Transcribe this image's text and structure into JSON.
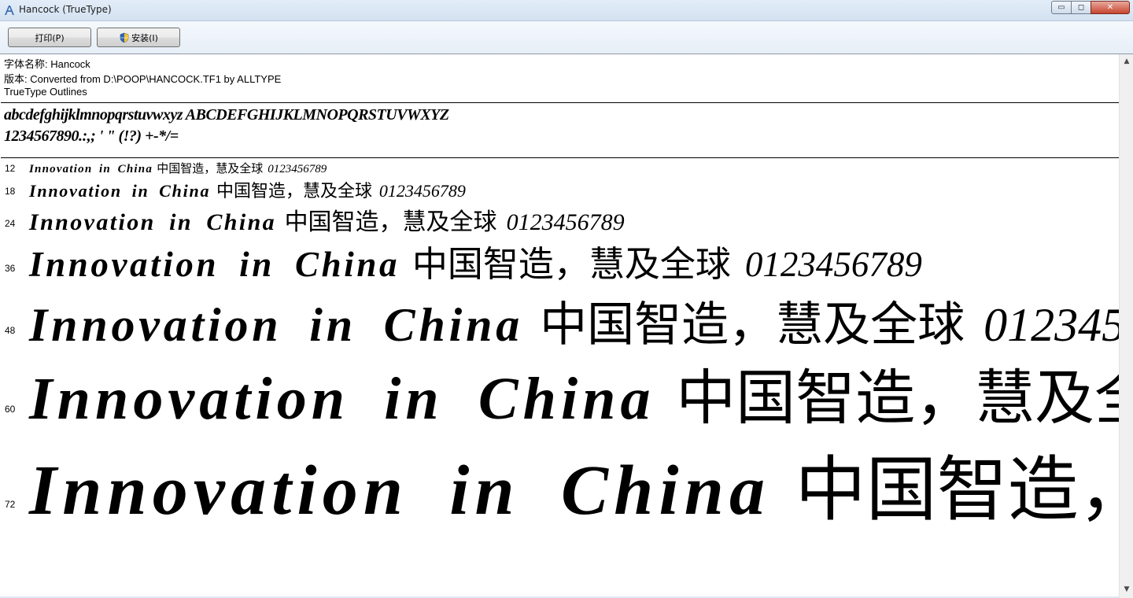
{
  "window": {
    "title": "Hancock (TrueType)",
    "minimize_glyph": "▭",
    "maximize_glyph": "◻",
    "close_glyph": "✕"
  },
  "toolbar": {
    "print_label": "打印(P)",
    "install_label": "安装(I)"
  },
  "info": {
    "font_name": "字体名称: Hancock",
    "version": "版本: Converted from D:\\POOP\\HANCOCK.TF1 by ALLTYPE",
    "outline_type": "TrueType Outlines"
  },
  "charset": {
    "line1": "abcdefghijklmnopqrstuvwxyz ABCDEFGHIJKLMNOPQRSTUVWXYZ",
    "line2": "1234567890.:,; ' \" (!?) +-*/="
  },
  "samples": {
    "latin": "Innovation in China",
    "cjk": "中国智造，慧及全球",
    "digits": "0123456789",
    "sizes": [
      "12",
      "18",
      "24",
      "36",
      "48",
      "60",
      "72"
    ]
  },
  "scrollbar": {
    "up": "▲",
    "down": "▼"
  }
}
